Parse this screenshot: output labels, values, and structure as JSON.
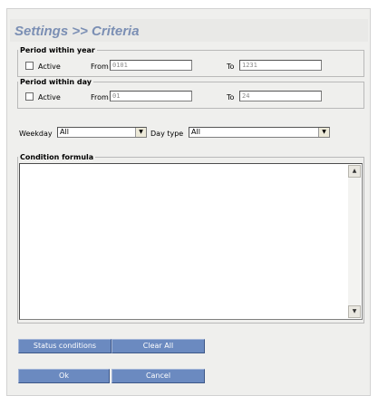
{
  "header": {
    "title": "Settings >> Criteria"
  },
  "year_period": {
    "legend": "Period within year",
    "active_label": "Active",
    "from_label": "From",
    "from_value": "0101",
    "to_label": "To",
    "to_value": "1231"
  },
  "day_period": {
    "legend": "Period within day",
    "active_label": "Active",
    "from_label": "From",
    "from_value": "01",
    "to_label": "To",
    "to_value": "24"
  },
  "filters": {
    "weekday_label": "Weekday",
    "weekday_value": "All",
    "daytype_label": "Day type",
    "daytype_value": "All"
  },
  "condition": {
    "legend": "Condition formula",
    "value": ""
  },
  "buttons": {
    "status_conditions": "Status conditions",
    "clear_all": "Clear All",
    "ok": "Ok",
    "cancel": "Cancel"
  },
  "icons": {
    "dropdown": "chevron-down-icon",
    "scroll_up": "arrow-up-icon",
    "scroll_down": "arrow-down-icon"
  },
  "colors": {
    "title": "#7b8fb4",
    "button": "#6b8ac0",
    "panel": "#efefed"
  }
}
